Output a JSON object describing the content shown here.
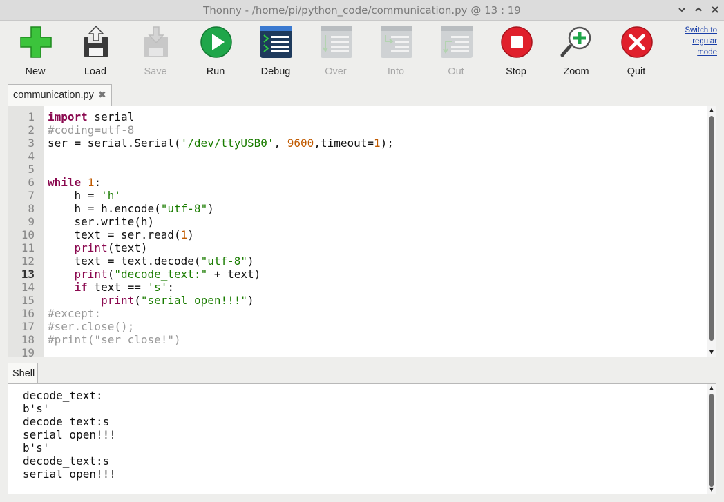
{
  "window": {
    "title": "Thonny  -  /home/pi/python_code/communication.py  @  13 : 19",
    "controls": [
      "minimize",
      "maximize",
      "close"
    ]
  },
  "toolbar": {
    "buttons": [
      {
        "id": "new",
        "label": "New",
        "icon": "new-file-plus-icon",
        "enabled": true
      },
      {
        "id": "load",
        "label": "Load",
        "icon": "load-floppy-icon",
        "enabled": true
      },
      {
        "id": "save",
        "label": "Save",
        "icon": "save-floppy-icon",
        "enabled": false
      },
      {
        "id": "run",
        "label": "Run",
        "icon": "run-play-icon",
        "enabled": true
      },
      {
        "id": "debug",
        "label": "Debug",
        "icon": "debug-icon",
        "enabled": true
      },
      {
        "id": "over",
        "label": "Over",
        "icon": "step-over-icon",
        "enabled": false
      },
      {
        "id": "into",
        "label": "Into",
        "icon": "step-into-icon",
        "enabled": false
      },
      {
        "id": "out",
        "label": "Out",
        "icon": "step-out-icon",
        "enabled": false
      },
      {
        "id": "stop",
        "label": "Stop",
        "icon": "stop-icon",
        "enabled": true
      },
      {
        "id": "zoom",
        "label": "Zoom",
        "icon": "zoom-icon",
        "enabled": true
      },
      {
        "id": "quit",
        "label": "Quit",
        "icon": "quit-icon",
        "enabled": true
      }
    ],
    "switch_mode_label": "Switch to regular mode"
  },
  "editor": {
    "tab_label": "communication.py",
    "tab_close": "✖",
    "current_line": 13,
    "line_numbers": [
      "1",
      "2",
      "3",
      "4",
      "5",
      "6",
      "7",
      "8",
      "9",
      "10",
      "11",
      "12",
      "13",
      "14",
      "15",
      "16",
      "17",
      "18",
      "19"
    ],
    "code_lines": [
      "import serial",
      "#coding=utf-8",
      "ser = serial.Serial('/dev/ttyUSB0', 9600,timeout=1);",
      "",
      "",
      "while 1:",
      "    h = 'h'",
      "    h = h.encode(\"utf-8\")",
      "    ser.write(h)",
      "    text = ser.read(1)",
      "    print(text)",
      "    text = text.decode(\"utf-8\")",
      "    print(\"decode_text:\" + text)",
      "    if text == 's':",
      "        print(\"serial open!!!\")",
      "#except:",
      "#ser.close();",
      "#print(\"ser close!\")",
      ""
    ]
  },
  "shell": {
    "tab_label": "Shell",
    "partial_line": "-",
    "output_lines": [
      "decode_text:",
      "b's'",
      "decode_text:s",
      "serial open!!!",
      "b's'",
      "decode_text:s",
      "serial open!!!"
    ]
  },
  "colors": {
    "keyword": "#8b0a50",
    "string": "#1a7c00",
    "number": "#c05a00",
    "comment": "#9a9a9a",
    "run_green": "#1fa64a",
    "stop_red": "#e0202c",
    "new_green": "#3cc43c",
    "link_blue": "#1a3fa8"
  }
}
